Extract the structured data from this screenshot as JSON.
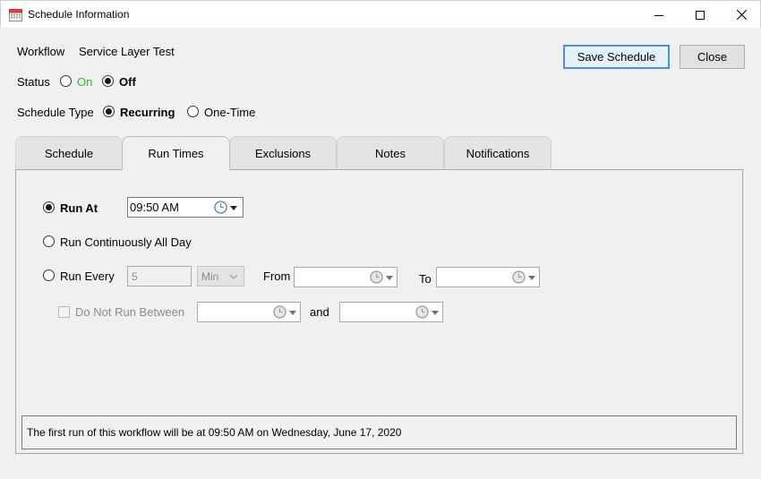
{
  "window": {
    "title": "Schedule Information"
  },
  "header": {
    "workflow_label": "Workflow",
    "workflow_value": "Service Layer Test",
    "status_label": "Status",
    "status_on": "On",
    "status_off": "Off",
    "schedule_type_label": "Schedule Type",
    "schedule_type_recurring": "Recurring",
    "schedule_type_onetime": "One-Time",
    "save_button": "Save Schedule",
    "close_button": "Close"
  },
  "tabs": [
    {
      "label": "Schedule"
    },
    {
      "label": "Run Times"
    },
    {
      "label": "Exclusions"
    },
    {
      "label": "Notes"
    },
    {
      "label": "Notifications"
    }
  ],
  "active_tab": "Run Times",
  "run_times": {
    "run_at_label": "Run At",
    "run_at_value": "09:50 AM",
    "run_continuously_label": "Run Continuously All Day",
    "run_every_label": "Run Every",
    "run_every_value": "5",
    "run_every_unit": "Min",
    "from_label": "From",
    "to_label": "To",
    "do_not_run_label": "Do Not Run Between",
    "and_label": "and",
    "selected_option": "Run At"
  },
  "status_message": "The first run of this workflow will be at 09:50 AM on Wednesday, June 17, 2020",
  "colors": {
    "status_on": "#2fb82f",
    "primary_button_border": "#4f8fd6",
    "disabled_text": "#8a8a8a"
  }
}
